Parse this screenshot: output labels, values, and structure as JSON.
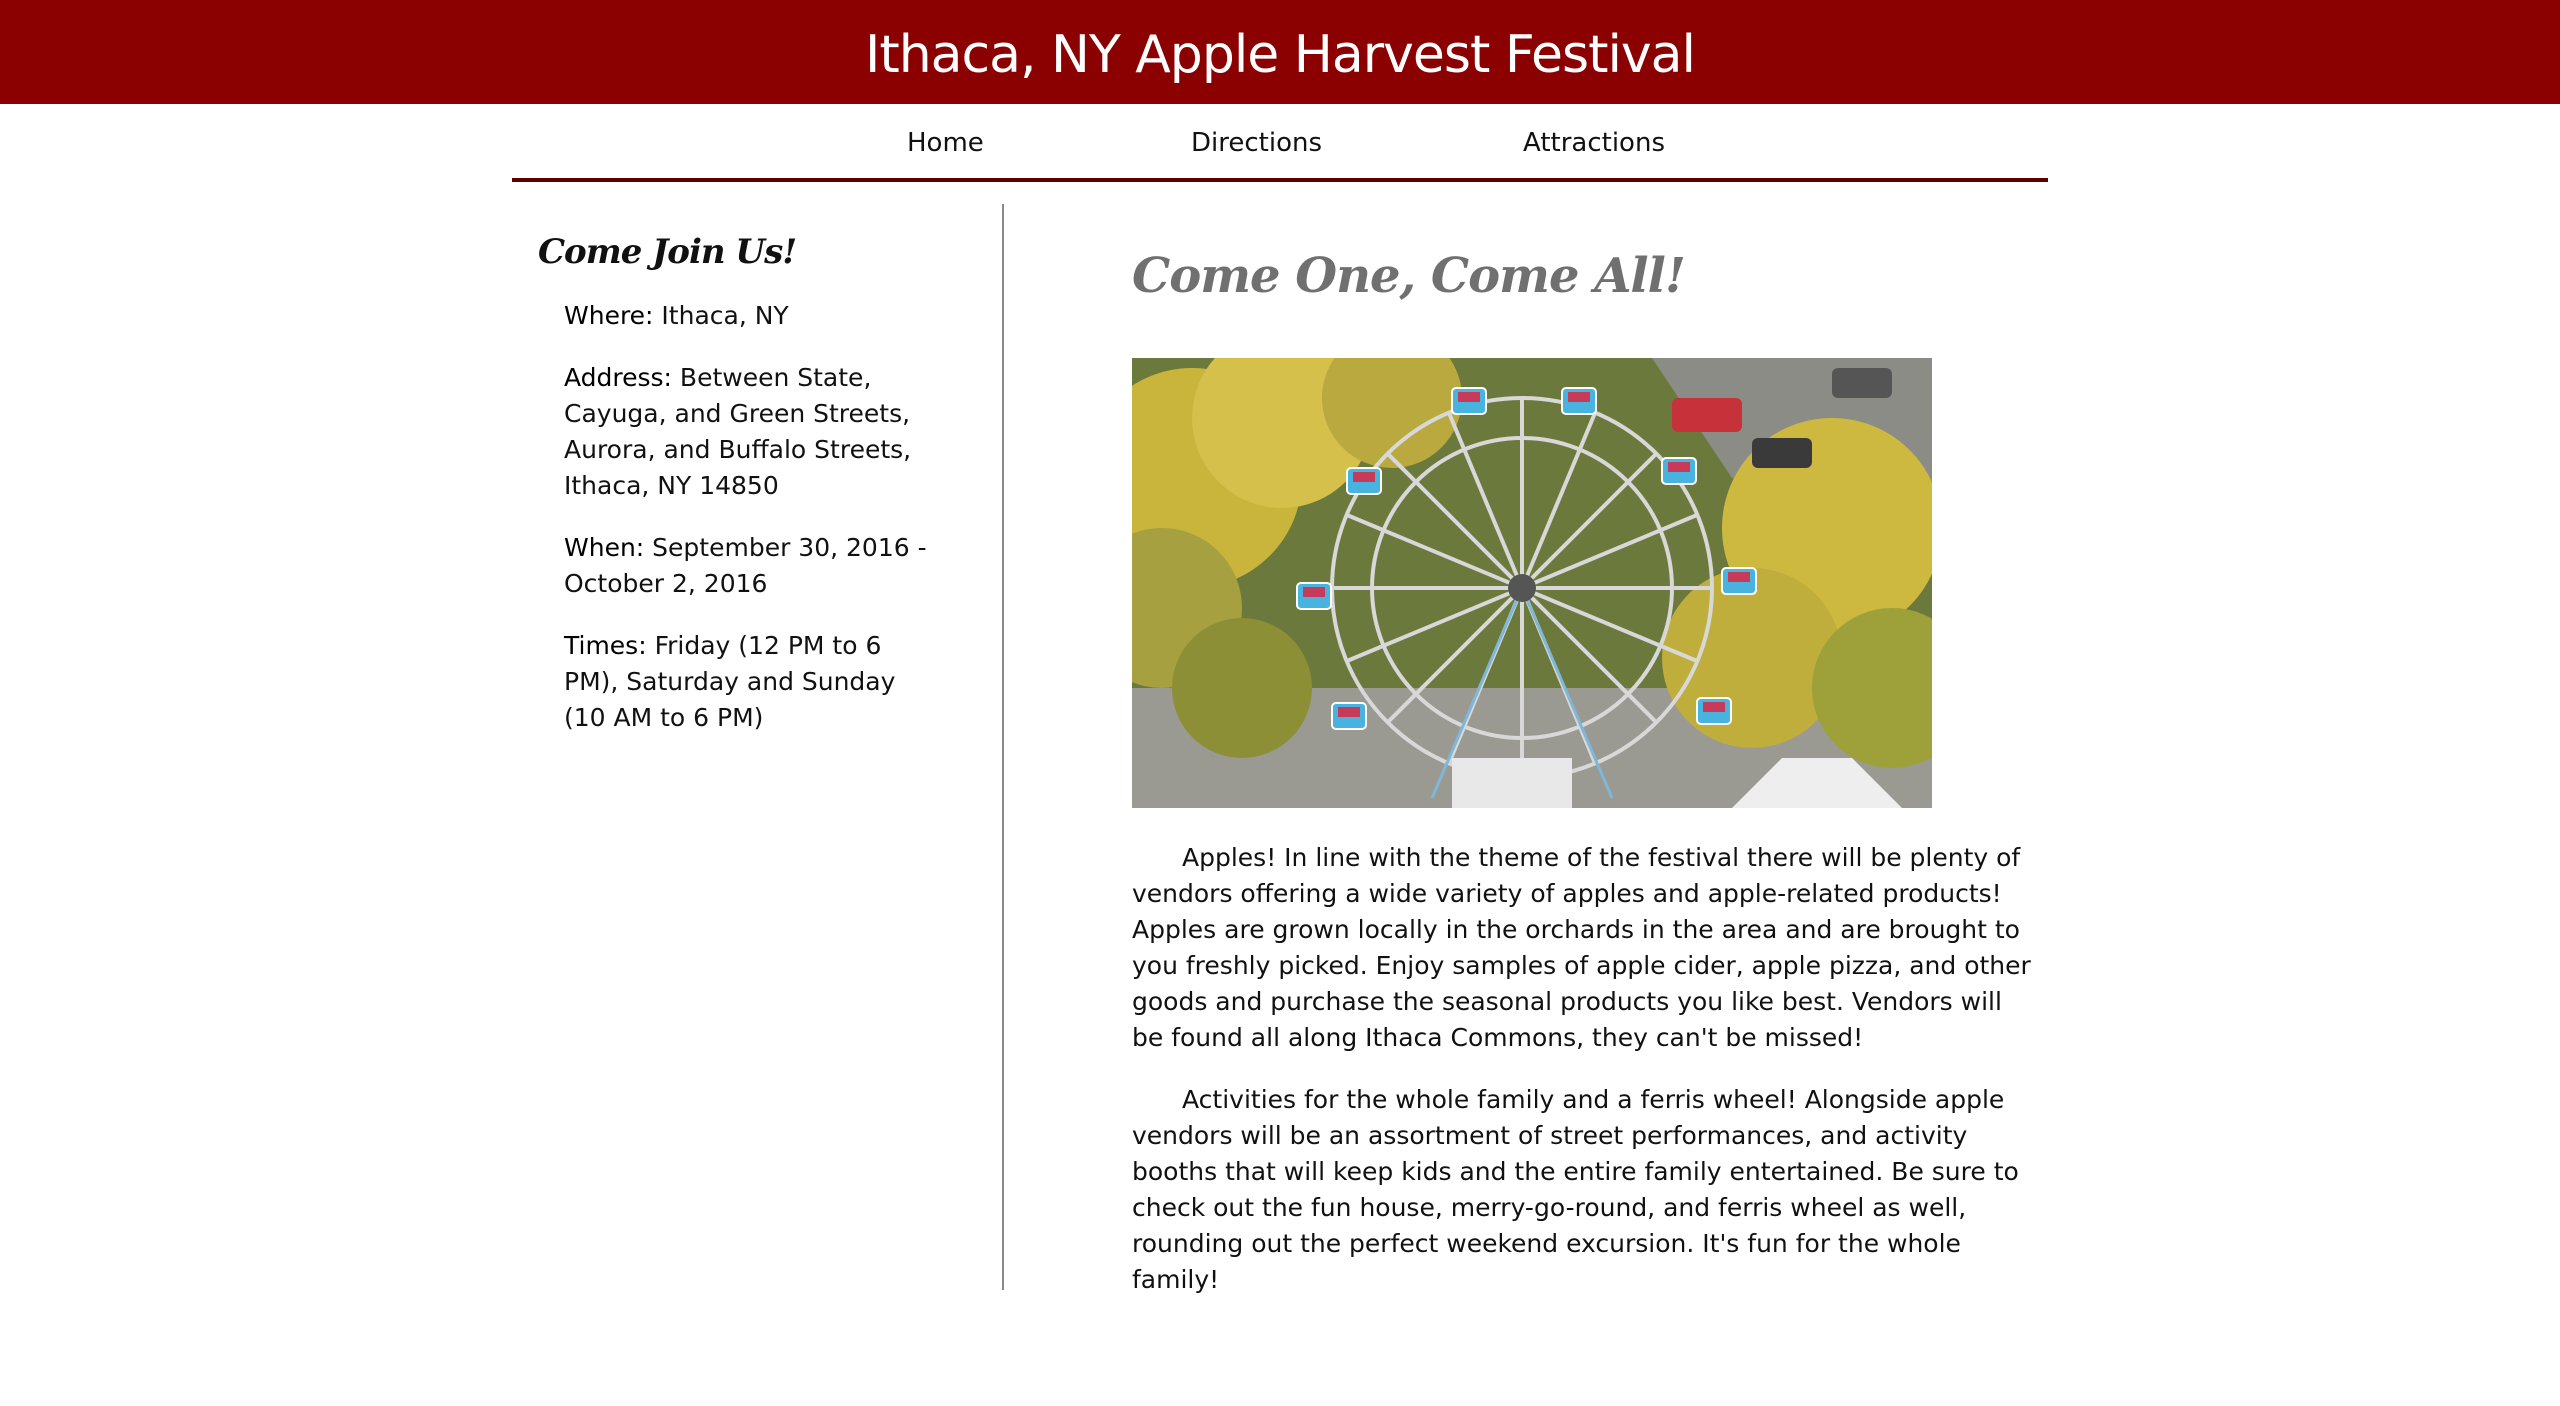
{
  "header": {
    "title": "Ithaca, NY Apple Harvest Festival",
    "background_color": "#8b0000"
  },
  "nav": {
    "items": [
      "Home",
      "Directions",
      "Attractions"
    ]
  },
  "sidebar": {
    "heading": "Come Join Us!",
    "where_label": "Where:",
    "where_value": " Ithaca, NY",
    "address_label": "Address:",
    "address_value": " Between State, Cayuga, and Green Streets, Aurora, and Buffalo Streets, Ithaca, NY 14850",
    "when_label": "When:",
    "when_value": " September 30, 2016 - October 2, 2016",
    "times_label": "Times:",
    "times_value": " Friday (12 PM to 6 PM), Saturday and Sunday (10 AM to 6 PM)"
  },
  "main": {
    "heading": "Come One, Come All!",
    "photo_alt": "Ferris wheel at the festival",
    "paragraphs": [
      "Apples! In line with the theme of the festival there will be plenty of vendors offering a wide variety of apples and apple-related products! Apples are grown locally in the orchards in the area and are brought to you freshly picked. Enjoy samples of apple cider, apple pizza, and other goods and purchase the seasonal products you like best. Vendors will be found all along Ithaca Commons, they can't be missed!",
      "Activities for the whole family and a ferris wheel! Alongside apple vendors will be an assortment of street performances, and activity booths that will keep kids and the entire family entertained. Be sure to check out the fun house, merry-go-round, and ferris wheel as well, rounding out the perfect weekend excursion. It's fun for the whole family!"
    ]
  }
}
